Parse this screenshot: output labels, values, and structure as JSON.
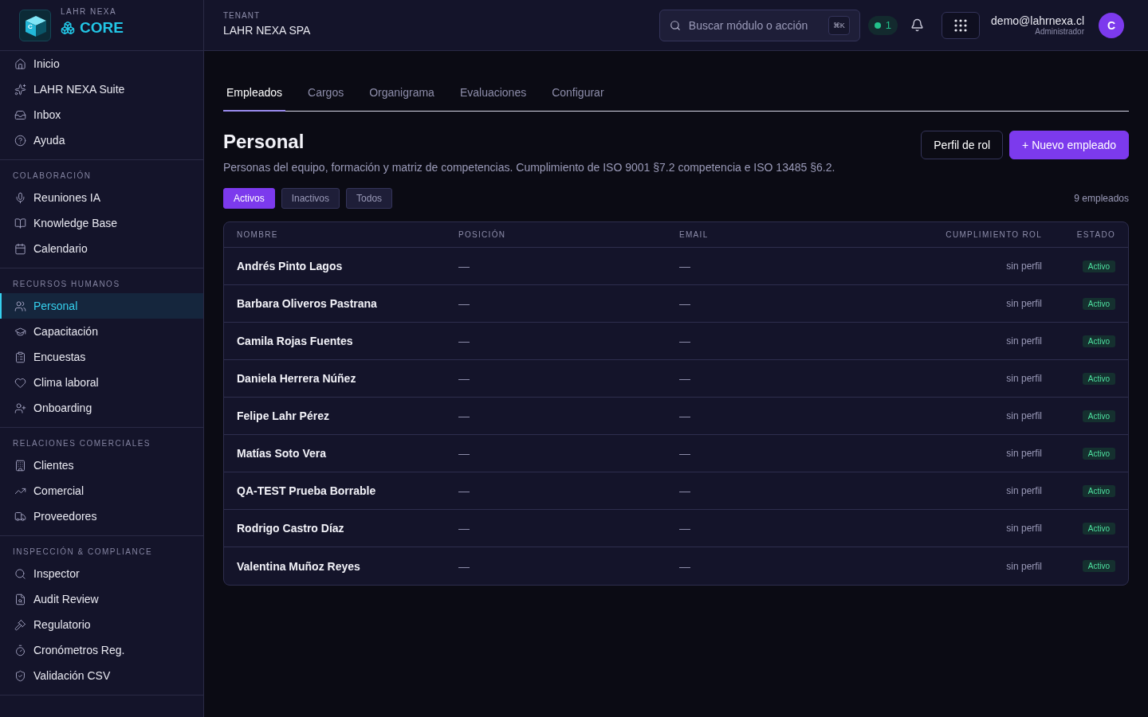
{
  "brand": {
    "overline": "LAHR NEXA",
    "name": "CORE",
    "logo_letter": "C"
  },
  "sidebar": {
    "sections": [
      {
        "items": [
          {
            "label": "Inicio",
            "selected": false
          },
          {
            "label": "LAHR NEXA Suite",
            "selected": false
          },
          {
            "label": "Inbox",
            "selected": false
          },
          {
            "label": "Ayuda",
            "selected": false
          }
        ]
      },
      {
        "title": "COLABORACIÓN",
        "items": [
          {
            "label": "Reuniones IA",
            "selected": false
          },
          {
            "label": "Knowledge Base",
            "selected": false
          },
          {
            "label": "Calendario",
            "selected": false
          }
        ]
      },
      {
        "title": "RECURSOS HUMANOS",
        "items": [
          {
            "label": "Personal",
            "selected": true
          },
          {
            "label": "Capacitación",
            "selected": false
          },
          {
            "label": "Encuestas",
            "selected": false
          },
          {
            "label": "Clima laboral",
            "selected": false
          },
          {
            "label": "Onboarding",
            "selected": false
          }
        ]
      },
      {
        "title": "RELACIONES COMERCIALES",
        "items": [
          {
            "label": "Clientes",
            "selected": false
          },
          {
            "label": "Comercial",
            "selected": false
          },
          {
            "label": "Proveedores",
            "selected": false
          }
        ]
      },
      {
        "title": "INSPECCIÓN & COMPLIANCE",
        "items": [
          {
            "label": "Inspector",
            "selected": false
          },
          {
            "label": "Audit Review",
            "selected": false
          },
          {
            "label": "Regulatorio",
            "selected": false
          },
          {
            "label": "Cronómetros Reg.",
            "selected": false
          },
          {
            "label": "Validación CSV",
            "selected": false
          }
        ]
      }
    ]
  },
  "header": {
    "tenant_label": "TENANT",
    "tenant": "LAHR NEXA SPA",
    "search": {
      "placeholder": "Buscar módulo o acción",
      "shortcut": "⌘K"
    },
    "status_count": "1",
    "user": {
      "email": "demo@lahrnexa.cl",
      "role": "Administrador",
      "initial": "C"
    }
  },
  "tabs": [
    {
      "label": "Empleados",
      "selected": true
    },
    {
      "label": "Cargos",
      "selected": false
    },
    {
      "label": "Organigrama",
      "selected": false
    },
    {
      "label": "Evaluaciones",
      "selected": false
    },
    {
      "label": "Configurar",
      "selected": false
    }
  ],
  "page": {
    "title": "Personal",
    "description": "Personas del equipo, formación y matriz de competencias. Cumplimiento de ISO 9001 §7.2 competencia e ISO 13485 §6.2.",
    "buttons": [
      {
        "label": "Perfil de rol",
        "kind": "secondary"
      },
      {
        "label": "+ Nuevo empleado",
        "kind": "primary"
      }
    ]
  },
  "filters": [
    {
      "label": "Activos",
      "selected": true
    },
    {
      "label": "Inactivos",
      "selected": false
    },
    {
      "label": "Todos",
      "selected": false
    }
  ],
  "count": "9 empleados",
  "table": {
    "columns": [
      "NOMBRE",
      "POSICIÓN",
      "EMAIL",
      "CUMPLIMIENTO ROL",
      "ESTADO"
    ],
    "rows": [
      {
        "name": "Andrés Pinto Lagos",
        "position": "—",
        "email": "—",
        "compliance": "sin perfil",
        "status": "Activo"
      },
      {
        "name": "Barbara Oliveros Pastrana",
        "position": "—",
        "email": "—",
        "compliance": "sin perfil",
        "status": "Activo"
      },
      {
        "name": "Camila Rojas Fuentes",
        "position": "—",
        "email": "—",
        "compliance": "sin perfil",
        "status": "Activo"
      },
      {
        "name": "Daniela Herrera Núñez",
        "position": "—",
        "email": "—",
        "compliance": "sin perfil",
        "status": "Activo"
      },
      {
        "name": "Felipe Lahr Pérez",
        "position": "—",
        "email": "—",
        "compliance": "sin perfil",
        "status": "Activo"
      },
      {
        "name": "Matías Soto Vera",
        "position": "—",
        "email": "—",
        "compliance": "sin perfil",
        "status": "Activo"
      },
      {
        "name": "QA-TEST Prueba Borrable",
        "position": "—",
        "email": "—",
        "compliance": "sin perfil",
        "status": "Activo"
      },
      {
        "name": "Rodrigo Castro Díaz",
        "position": "—",
        "email": "—",
        "compliance": "sin perfil",
        "status": "Activo"
      },
      {
        "name": "Valentina Muñoz Reyes",
        "position": "—",
        "email": "—",
        "compliance": "sin perfil",
        "status": "Activo"
      }
    ]
  }
}
